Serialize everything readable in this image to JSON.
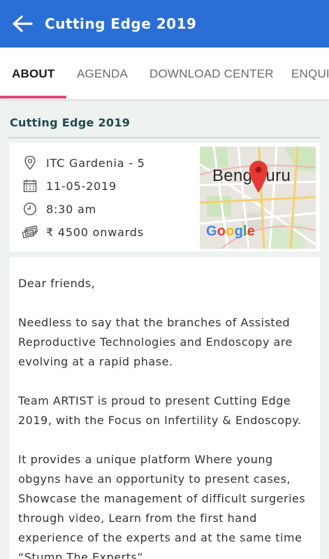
{
  "appbar": {
    "title": "Cutting Edge 2019"
  },
  "tabs": [
    {
      "label": "ABOUT"
    },
    {
      "label": "AGENDA"
    },
    {
      "label": "DOWNLOAD CENTER"
    },
    {
      "label": "ENQUI"
    }
  ],
  "section": {
    "title": "Cutting Edge 2019"
  },
  "event": {
    "venue": "ITC Gardenia - 5",
    "date": "11-05-2019",
    "time": "8:30 am",
    "price": "₹ 4500 onwards"
  },
  "map": {
    "city_label": "Bengaluru",
    "provider": "Google"
  },
  "content": {
    "greeting": "Dear friends,",
    "p1": "Needless to say that the branches of Assisted Reproductive Technologies and Endoscopy are evolving at a rapid phase.",
    "p2": "Team ARTIST is proud to present Cutting Edge 2019, with the Focus on Infertility & Endoscopy.",
    "p3": "It provides a unique platform Where young obgyns have an opportunity to present cases, Showcase the management of difficult surgeries through video, Learn from the first hand experience of the experts and at the same time “Stump The Experts”."
  },
  "colors": {
    "appbar": "#2a6fd6",
    "tab_indicator": "#e0487a",
    "section_title": "#1f4b4f"
  }
}
